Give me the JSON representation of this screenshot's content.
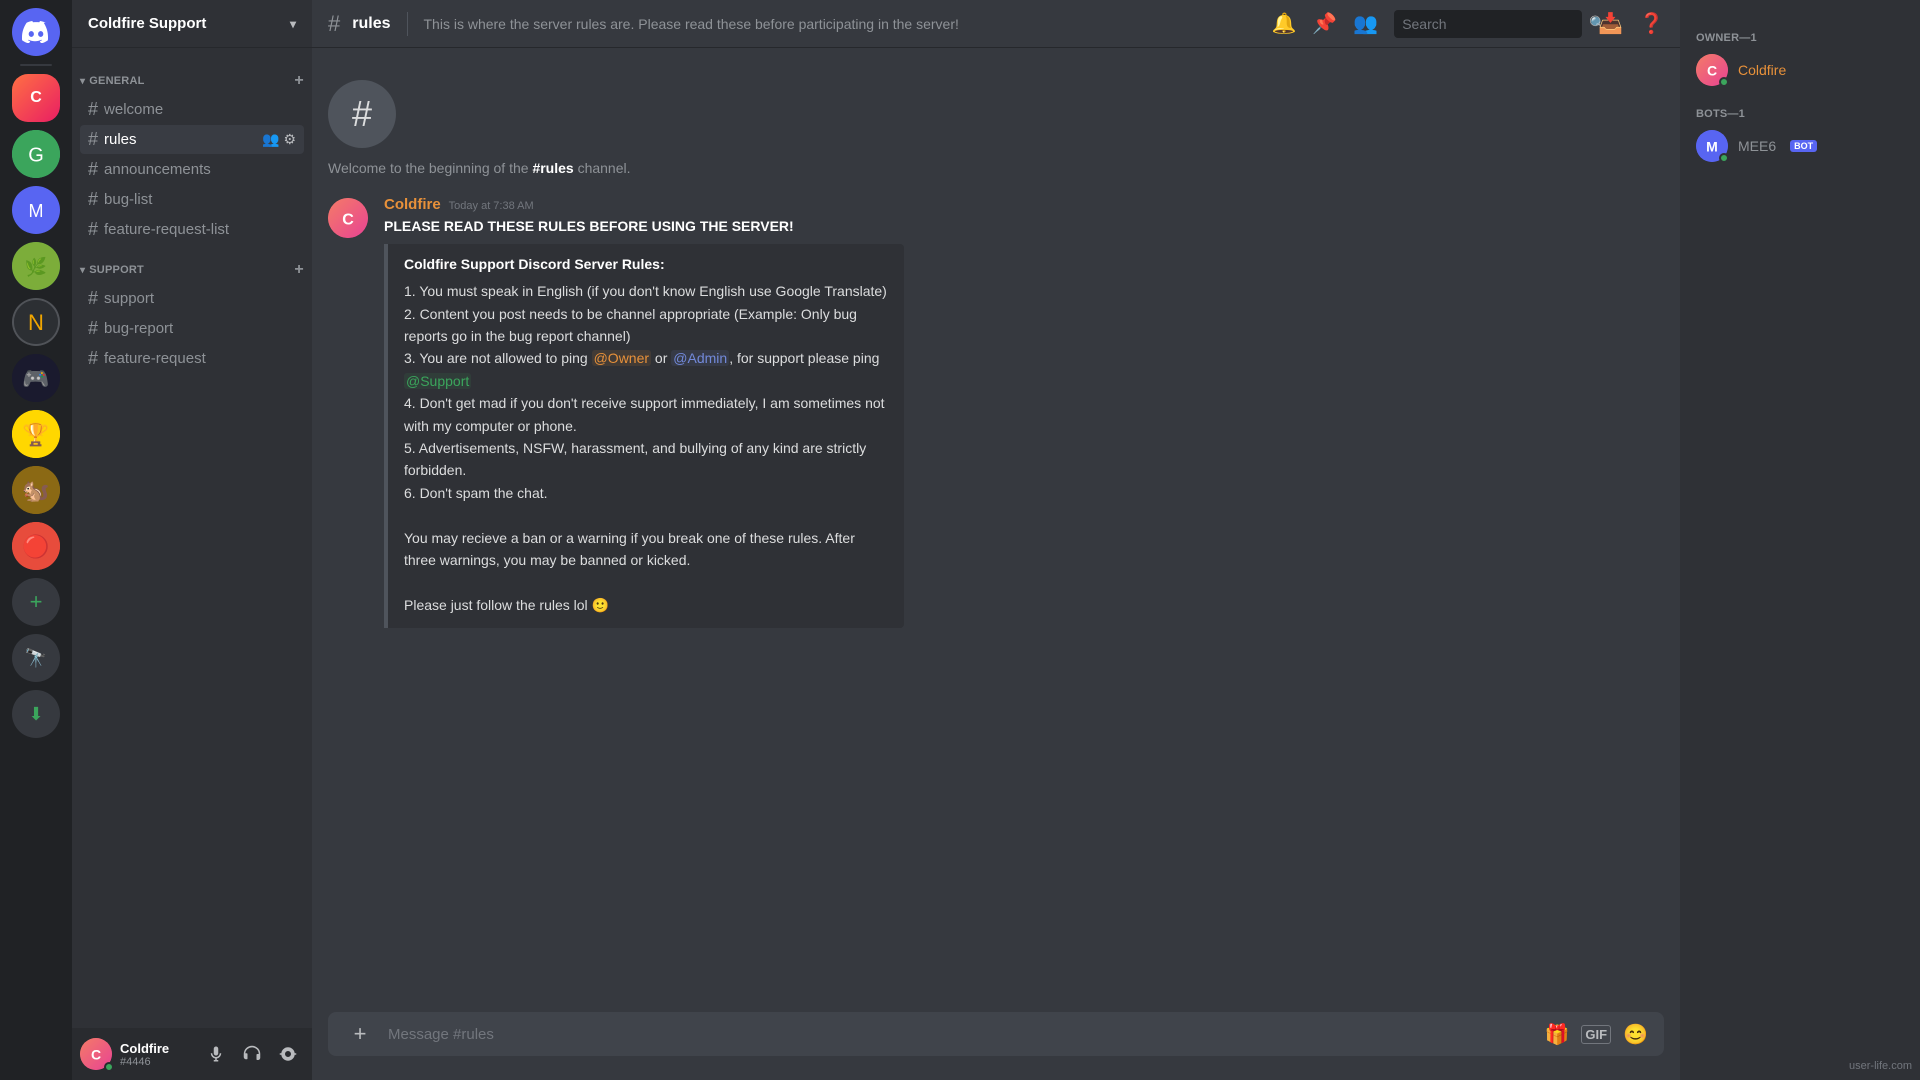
{
  "app": {
    "title": "Discord"
  },
  "server": {
    "name": "Coldfire Support",
    "chevron": "▾"
  },
  "categories": [
    {
      "id": "general",
      "label": "GENERAL",
      "channels": [
        {
          "id": "welcome",
          "name": "welcome",
          "active": false
        },
        {
          "id": "rules",
          "name": "rules",
          "active": true
        },
        {
          "id": "announcements",
          "name": "announcements",
          "active": false
        },
        {
          "id": "bug-list",
          "name": "bug-list",
          "active": false
        },
        {
          "id": "feature-request-list",
          "name": "feature-request-list",
          "active": false
        }
      ]
    },
    {
      "id": "support",
      "label": "SUPPORT",
      "channels": [
        {
          "id": "support",
          "name": "support",
          "active": false
        },
        {
          "id": "bug-report",
          "name": "bug-report",
          "active": false
        },
        {
          "id": "feature-request",
          "name": "feature-request",
          "active": false
        }
      ]
    }
  ],
  "user": {
    "name": "Coldfire",
    "tag": "#4446",
    "status": "online"
  },
  "channel": {
    "name": "rules",
    "topic": "This is where the server rules are. Please read these before participating in the server!",
    "beginning_text": "Welcome to the beginning of the ",
    "beginning_channel": "#rules",
    "beginning_suffix": " channel."
  },
  "message": {
    "author": "Coldfire",
    "timestamp": "Today at 7:38 AM",
    "headline": "PLEASE READ THESE RULES BEFORE USING THE SERVER!",
    "embed_title": "Coldfire Support Discord Server Rules:",
    "rules": [
      "1. You must speak in English (if you don't know English use Google Translate)",
      "2. Content you post needs to be channel appropriate (Example: Only bug reports go in the bug report channel)",
      "3. You are not allowed to ping @Owner or @Admin, for support please ping @Support",
      "4. Don't get mad if you don't receive support immediately, I am sometimes not with my computer or phone.",
      "5. Advertisements, NSFW, harassment, and bullying of any kind are strictly forbidden.",
      "6. Don't spam the chat."
    ],
    "rule3_plain": "3. You are not allowed to ping ",
    "rule3_mention1": "@Owner",
    "rule3_mid": " or ",
    "rule3_mention2": "@Admin",
    "rule3_end": ", for support please ping ",
    "rule3_mention3": "@Support",
    "warning_text": "You may recieve a ban or a warning if you break one of these rules. After three warnings, you may be banned or kicked.",
    "followup_text": "Please just follow the rules lol 🙂"
  },
  "members": {
    "owner_label": "OWNER—1",
    "owner_name": "Coldfire",
    "bots_label": "BOTS—1",
    "bot_name": "MEE6",
    "bot_badge": "BOT"
  },
  "input": {
    "placeholder": "Message #rules"
  },
  "header": {
    "search_placeholder": "Search"
  },
  "toolbar": {
    "add_server": "+",
    "explore": "🔭"
  },
  "watermark": "user-life.com"
}
